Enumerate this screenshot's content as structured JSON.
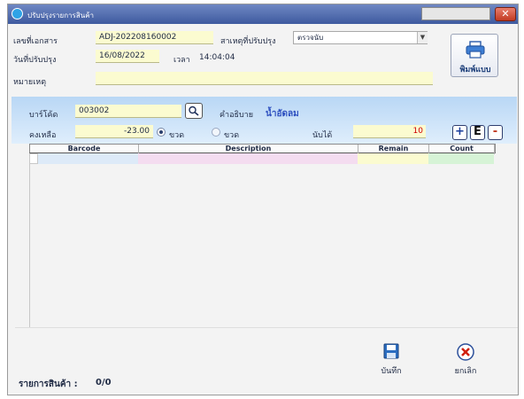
{
  "window": {
    "title": "ปรับปรุงรายการสินค้า"
  },
  "header": {
    "doc_no_label": "เลขที่เอกสาร",
    "doc_no_value": "ADJ-202208160002",
    "reason_label": "สาเหตุที่ปรับปรุง",
    "reason_value": "ตรวจนับ",
    "date_label": "วันที่ปรับปรุง",
    "date_value": "16/08/2022",
    "time_label": "เวลา",
    "time_value": "14:04:04",
    "note_label": "หมายเหตุ",
    "note_value": "",
    "print_label": "พิมพ์แบบ"
  },
  "entry": {
    "barcode_label": "บาร์โค้ด",
    "barcode_value": "003002",
    "desc_label": "คำอธิบาย",
    "desc_value": "น้ำอัดลม",
    "balance_label": "คงเหลือ",
    "balance_value": "-23.00",
    "unit_option1": "ขวด",
    "unit_option2": "ขวด",
    "count_label": "นับได้",
    "count_value": "10",
    "plus_label": "+",
    "e_label": "E",
    "minus_label": "-"
  },
  "table": {
    "columns": [
      "Barcode",
      "Description",
      "Remain",
      "Count"
    ]
  },
  "footer": {
    "items_label": "รายการสินค้า :",
    "items_value": "0/0",
    "save_label": "บันทึก",
    "cancel_label": "ยกเลิก"
  },
  "icons": {
    "title": "app-icon",
    "close": "close-icon",
    "print": "printer-icon",
    "search": "search-icon",
    "save": "save-icon",
    "cancel": "cancel-icon"
  },
  "colors": {
    "title_bar": "#4e6aae",
    "field_bg": "#fbfbd0",
    "panel_top": "#b9d7f5",
    "accent_blue": "#1d3f7a",
    "accent_red": "#c23a22",
    "desc_highlight": "#2d4fbf"
  }
}
